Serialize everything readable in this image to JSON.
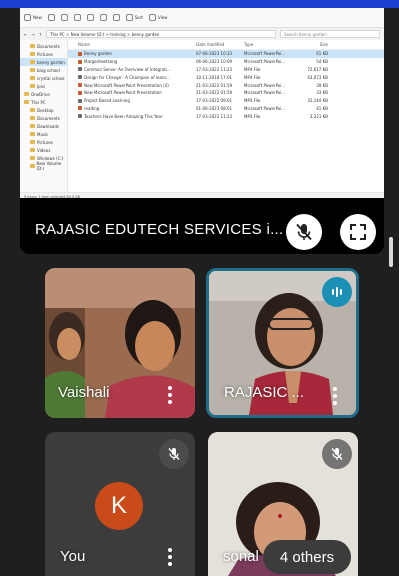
{
  "explorer": {
    "toolbar": {
      "new_label": "New",
      "sort_label": "Sort",
      "view_label": "View"
    },
    "address": {
      "path": "This PC  >  New Volume (D:)  >  training  >  beeny garden",
      "search_placeholder": "Search beeny garden"
    },
    "nav_items": [
      {
        "label": "Documents",
        "indent": true
      },
      {
        "label": "Pictures",
        "indent": true
      },
      {
        "label": "beeny garden",
        "indent": true,
        "active": true
      },
      {
        "label": "blog school",
        "indent": true
      },
      {
        "label": "crystal school",
        "indent": true
      },
      {
        "label": "Iplsi",
        "indent": true
      },
      {
        "label": "OneDrive",
        "indent": false
      },
      {
        "label": "This PC",
        "indent": false
      },
      {
        "label": "Desktop",
        "indent": true
      },
      {
        "label": "Documents",
        "indent": true
      },
      {
        "label": "Downloads",
        "indent": true
      },
      {
        "label": "Music",
        "indent": true
      },
      {
        "label": "Pictures",
        "indent": true
      },
      {
        "label": "Videos",
        "indent": true
      },
      {
        "label": "Windows (C:)",
        "indent": true
      },
      {
        "label": "New Volume (D:)",
        "indent": true
      }
    ],
    "columns": {
      "name": "Name",
      "date": "Date modified",
      "type": "Type",
      "size": "Size"
    },
    "files": [
      {
        "name": "Beeny garden",
        "date": "07-06-2023 10:33",
        "type": "Microsoft PowerPoi...",
        "size": "61 KB",
        "icon": "ppt",
        "selected": true
      },
      {
        "name": "Margosheetsong",
        "date": "06-06-2023 10:09",
        "type": "Microsoft PowerPoi...",
        "size": "54 KB",
        "icon": "ppt"
      },
      {
        "name": "Common Sense- An Overview of Integrati...",
        "date": "17-03-2022 11:23",
        "type": "MP4 File",
        "size": "72,617 KB",
        "icon": "mp4"
      },
      {
        "name": "Design for Change - A Champion of learn...",
        "date": "10-11-2018 17:01",
        "type": "MP4 File",
        "size": "43,073 KB",
        "icon": "mp4"
      },
      {
        "name": "New Microsoft PowerPoint Presentation (4)",
        "date": "21-03-2022 01:59",
        "type": "Microsoft PowerPoi...",
        "size": "39 KB",
        "icon": "ppt"
      },
      {
        "name": "New Microsoft PowerPoint Presentation",
        "date": "21-03-2022 01:59",
        "type": "Microsoft PowerPoi...",
        "size": "33 KB",
        "icon": "ppt"
      },
      {
        "name": "Project Based Learning",
        "date": "17-03-2022 09:01",
        "type": "MP4 File",
        "size": "32,144 KB",
        "icon": "mp4"
      },
      {
        "name": "reading",
        "date": "01-06-2023 08:01",
        "type": "Microsoft PowerPoi...",
        "size": "41 KB",
        "icon": "ppt"
      },
      {
        "name": "Teachers Have Been Amazing This Year",
        "date": "17-03-2022 11:23",
        "type": "MP4 File",
        "size": "3,221 KB",
        "icon": "mp4"
      }
    ],
    "status": "9 items    1 item selected  60.9 KB"
  },
  "presenter": {
    "name": "RAJASIC EDUTECH SERVICES i..."
  },
  "participants": [
    {
      "name": "Vaishali"
    },
    {
      "name": "RAJASIC ..."
    },
    {
      "name": "You",
      "initial": "K",
      "avatar_color": "#c94b1a"
    },
    {
      "name": "sonal"
    }
  ],
  "others_label": "4 others",
  "colors": {
    "accent_bar": "#1c3fcf",
    "active_speaker_border": "#1f6d8a",
    "speaking_indicator": "#1c8fb5"
  }
}
